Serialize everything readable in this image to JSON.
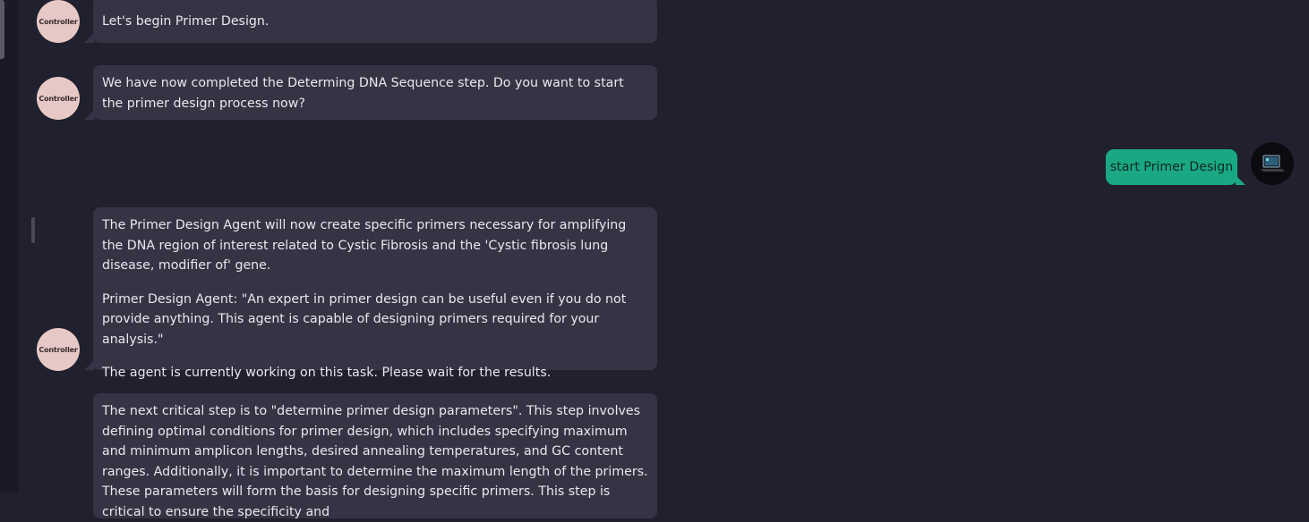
{
  "controller_label": "Controller",
  "messages": [
    {
      "role": "controller",
      "paragraphs": [
        "Let's begin Primer Design."
      ]
    },
    {
      "role": "controller",
      "paragraphs": [
        "We have now completed the Determing DNA Sequence step. Do you want to start the primer design process now?"
      ]
    },
    {
      "role": "user",
      "text": "start Primer Design"
    },
    {
      "role": "controller",
      "paragraphs": [
        "The Primer Design Agent will now create specific primers necessary for amplifying the DNA region of interest related to Cystic Fibrosis and the 'Cystic fibrosis lung disease, modifier of' gene.",
        "Primer Design Agent: \"An expert in primer design can be useful even if you do not provide anything. This agent is capable of designing primers required for your analysis.\"",
        "The agent is currently working on this task. Please wait for the results."
      ]
    },
    {
      "role": "controller",
      "paragraphs": [
        "The next critical step is to \"determine primer design parameters\". This step involves defining optimal conditions for primer design, which includes specifying maximum and minimum amplicon lengths, desired annealing temperatures, and GC content ranges. Additionally, it is important to determine the maximum length of the primers. These parameters will form the basis for designing specific primers. This step is critical to ensure the specificity and"
      ]
    }
  ],
  "colors": {
    "background": "#20202e",
    "bubble": "#343444",
    "user_bubble": "#1aa784",
    "avatar": "#e6c9c6"
  },
  "icons": {
    "user_avatar": "laptop-icon"
  }
}
